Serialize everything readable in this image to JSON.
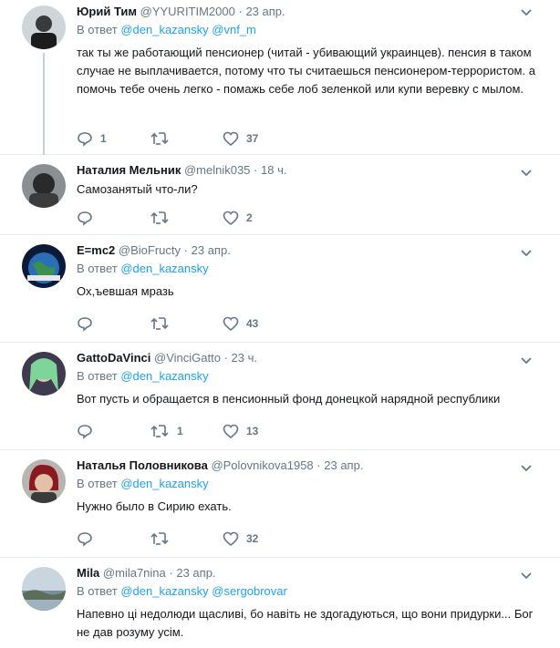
{
  "colors": {
    "link": "#1da1f2",
    "muted": "#657786",
    "text": "#14171a",
    "divider": "#e6ecf0"
  },
  "tweets": [
    {
      "name": "Юрий Тим",
      "handle": "@YYURITIM2000",
      "dot": "·",
      "time": "23 апр.",
      "reply_prefix": "В ответ",
      "mentions": [
        "@den_kazansky",
        "@vnf_m"
      ],
      "text": "так ты же работающий пенсионер (читай - убивающий украинцев). пенсия в таком случае не выплачивается, потому что ты считаешься пенсионером-террористом.  а помочь тебе очень легко - помажь себе лоб зеленкой или купи веревку с мылом.",
      "replies": "1",
      "retweets": "",
      "likes": "37",
      "avatar_icon": "user-avatar"
    },
    {
      "name": "Наталия Мельник",
      "handle": "@melnik035",
      "dot": "·",
      "time": "18 ч.",
      "reply_prefix": "",
      "mentions": [],
      "text": "Самозанятый что-ли?",
      "replies": "",
      "retweets": "",
      "likes": "2",
      "avatar_icon": "user-avatar"
    },
    {
      "name": "E=mc2",
      "handle": "@BioFructy",
      "dot": "·",
      "time": "23 апр.",
      "reply_prefix": "В ответ",
      "mentions": [
        "@den_kazansky"
      ],
      "text": "Ох,ъевшая мразь",
      "replies": "",
      "retweets": "",
      "likes": "43",
      "avatar_icon": "earth-avatar"
    },
    {
      "name": "GattoDaVinci",
      "handle": "@VinciGatto",
      "dot": "·",
      "time": "23 ч.",
      "reply_prefix": "В ответ",
      "mentions": [
        "@den_kazansky"
      ],
      "text": "Вот пусть и обращается в пенсионный фонд донецкой нарядной республики",
      "replies": "",
      "retweets": "1",
      "likes": "13",
      "avatar_icon": "user-avatar"
    },
    {
      "name": "Наталья Половникова",
      "handle": "@Polovnikova1958",
      "dot": "·",
      "time": "23 апр.",
      "reply_prefix": "В ответ",
      "mentions": [
        "@den_kazansky"
      ],
      "text": "Нужно было в Сирию ехать.",
      "replies": "",
      "retweets": "",
      "likes": "32",
      "avatar_icon": "user-avatar"
    },
    {
      "name": "Mila",
      "handle": "@mila7nina",
      "dot": "·",
      "time": "23 апр.",
      "reply_prefix": "В ответ",
      "mentions": [
        "@den_kazansky",
        "@sergobrovar"
      ],
      "text": "Напевно ці недолюди щасливі, бо навіть не здогадуються, що вони придурки...  Бог не дав розуму усім.",
      "replies": "",
      "retweets": "",
      "likes": "",
      "avatar_icon": "landscape-avatar"
    }
  ]
}
